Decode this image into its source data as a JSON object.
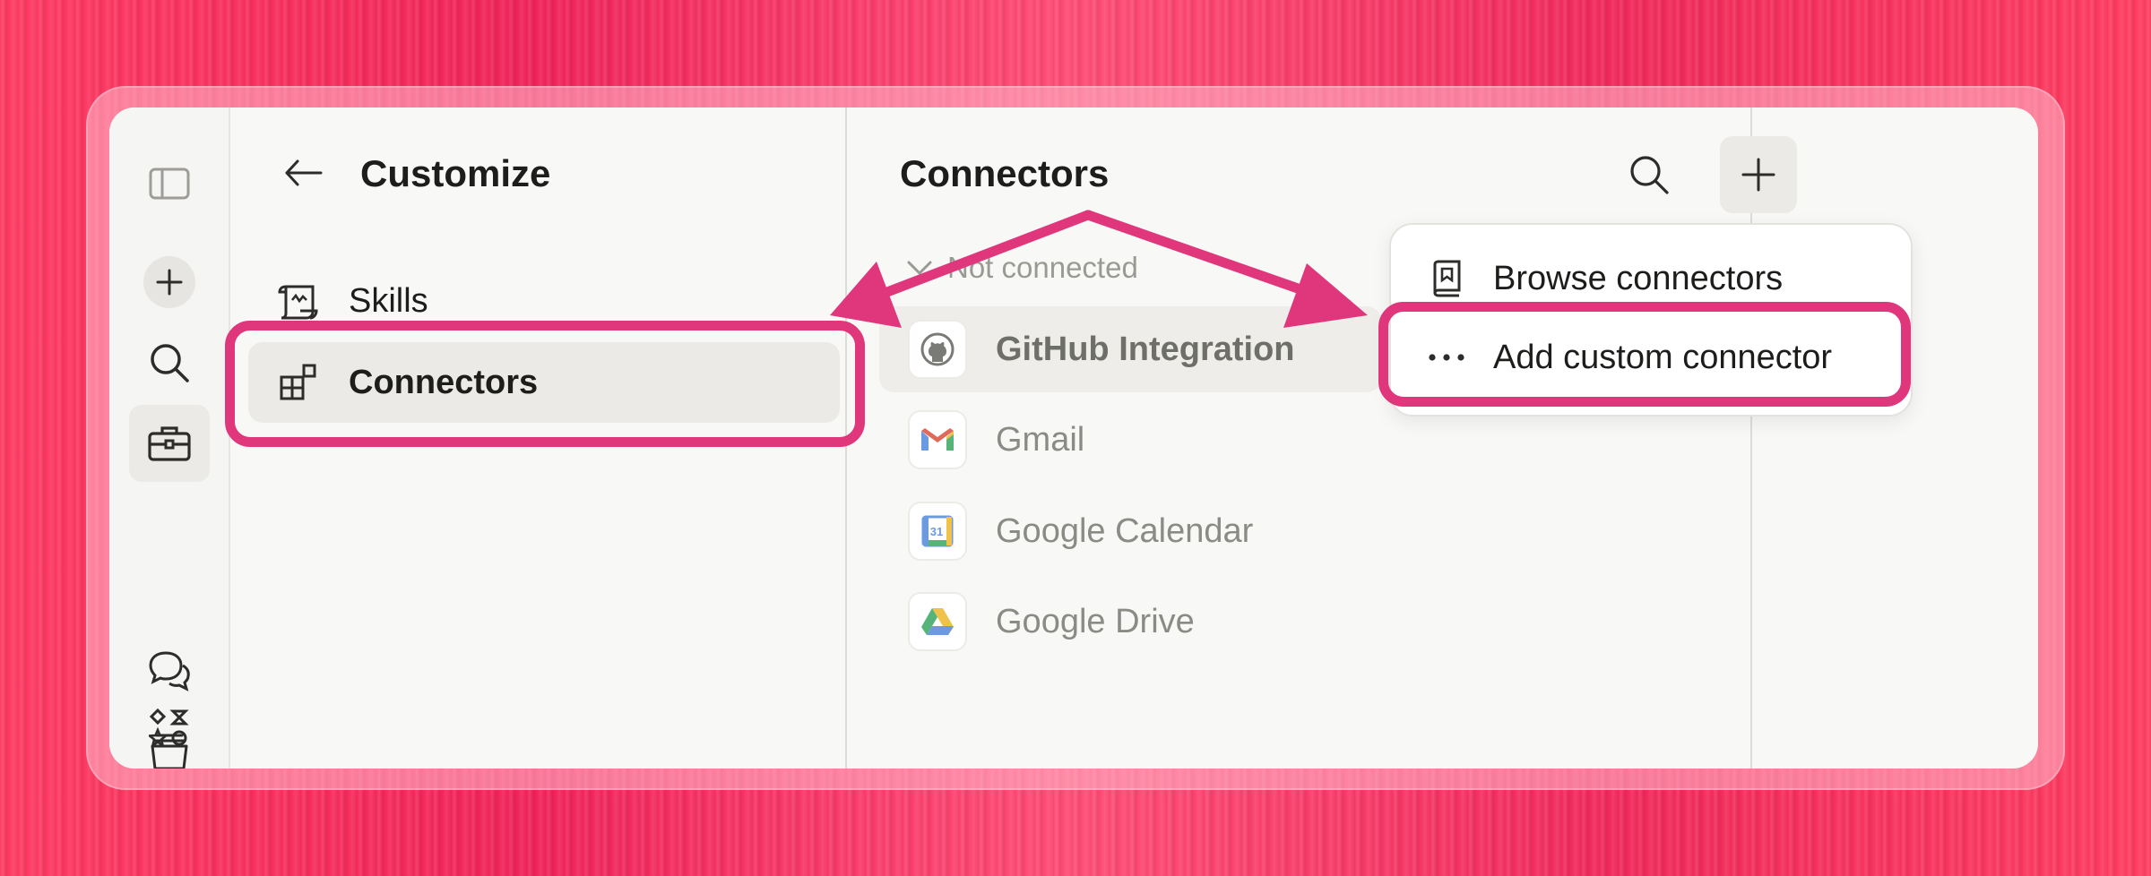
{
  "customize": {
    "back_label": "←",
    "title": "Customize",
    "items": [
      {
        "label": "Skills",
        "icon": "scroll-icon"
      },
      {
        "label": "Connectors",
        "icon": "connectors-icon"
      }
    ]
  },
  "connectors": {
    "title": "Connectors",
    "section_label": "Not connected",
    "items": [
      {
        "name": "GitHub Integration",
        "icon": "github-logo"
      },
      {
        "name": "Gmail",
        "icon": "gmail-logo"
      },
      {
        "name": "Google Calendar",
        "icon": "google-calendar-logo",
        "badge": "31"
      },
      {
        "name": "Google Drive",
        "icon": "google-drive-logo"
      }
    ]
  },
  "menu": {
    "items": [
      {
        "label": "Browse connectors",
        "icon": "book-icon"
      },
      {
        "label": "Add custom connector",
        "icon": "more-dots-icon"
      }
    ]
  },
  "colors": {
    "highlight": "#e0367c",
    "background": "#ff3d63"
  }
}
